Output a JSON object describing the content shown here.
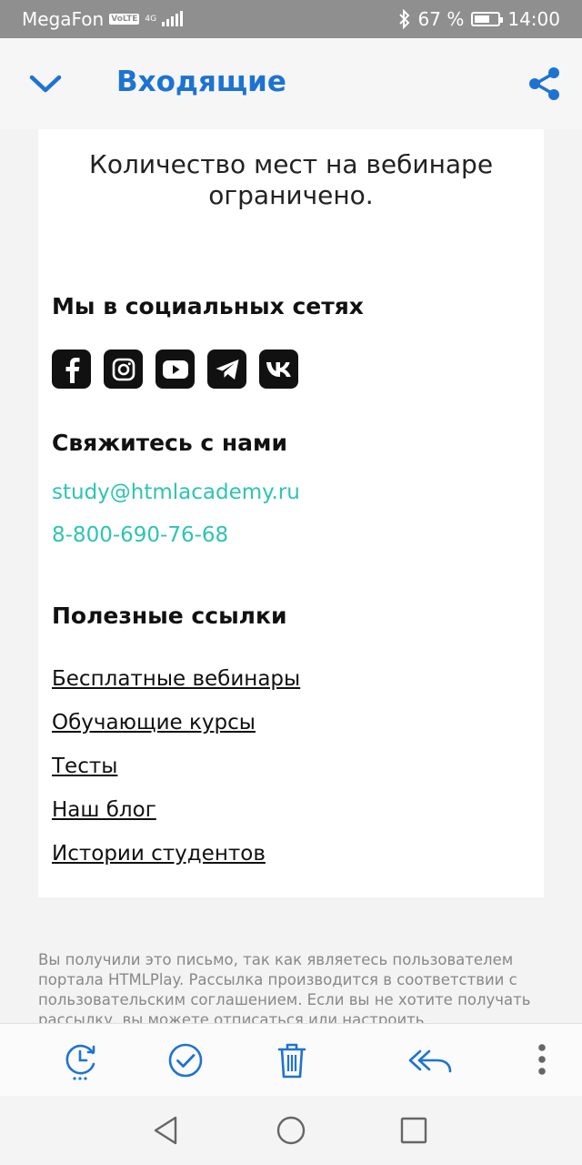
{
  "status_bar": {
    "carrier": "MegaFon",
    "volte": "VoLTE",
    "network": "4G",
    "network_sub": "4G+",
    "battery_percent": "67 %",
    "battery_level": 0.67,
    "time": "14:00"
  },
  "header": {
    "title": "Входящие",
    "back_icon": "chevron-down-icon",
    "share_icon": "share-icon"
  },
  "email": {
    "limited_seats": "Количество мест на вебинаре ограничено.",
    "social_heading": "Мы в социальных сетях",
    "social_icons": [
      "facebook-icon",
      "instagram-icon",
      "youtube-icon",
      "telegram-icon",
      "vk-icon"
    ],
    "contact_heading": "Свяжитесь с нами",
    "email": "study@htmlacademy.ru",
    "phone": "8-800-690-76-68",
    "links_heading": "Полезные ссылки",
    "links": [
      "Бесплатные вебинары",
      "Обучающие курсы",
      "Тесты",
      "Наш блог",
      "Истории студентов"
    ],
    "footer_note": "Вы получили это письмо, так как являетесь пользователем портала HTMLPlay. Рассылка производится в соответствии с пользовательским соглашением. Если вы не хотите получать рассылку, вы можете отписаться или настроить"
  },
  "toolbar": {
    "icons": [
      "snooze-icon",
      "check-circle-icon",
      "trash-icon",
      "reply-all-icon",
      "more-vertical-icon"
    ]
  },
  "navbar": {
    "icons": [
      "back-triangle-icon",
      "home-circle-icon",
      "recents-square-icon"
    ]
  },
  "colors": {
    "accent": "#1e73d2",
    "link_teal": "#2dc4b2",
    "status_bar": "#8f8f8f"
  }
}
